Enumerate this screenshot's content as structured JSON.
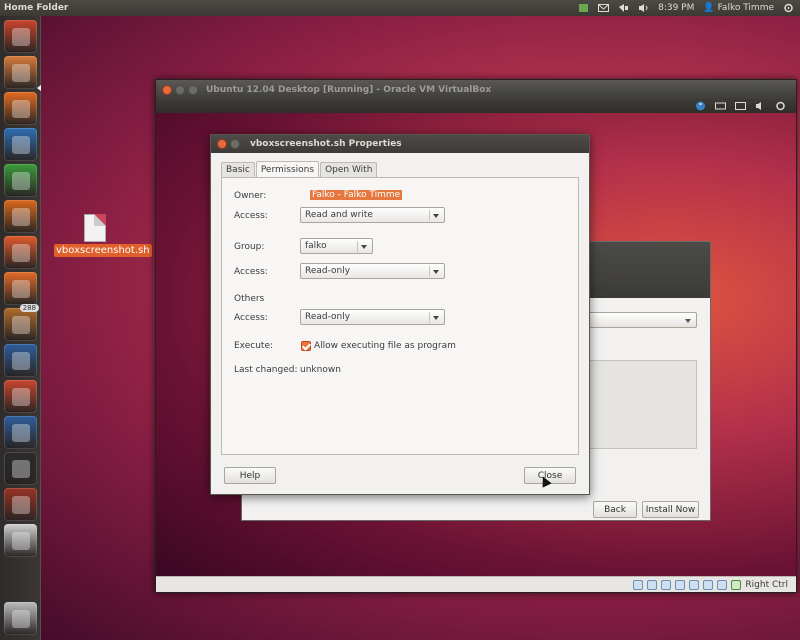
{
  "top_panel": {
    "title": "Home Folder",
    "time": "8:39 PM",
    "user": "Falko Timme",
    "icons": [
      "indicator-icon",
      "envelope-icon",
      "network-icon",
      "volume-icon",
      "gear-icon"
    ]
  },
  "launcher": {
    "items": [
      {
        "name": "ubuntu-dash-icon",
        "color": "#c9452b"
      },
      {
        "name": "home-folder-icon",
        "color": "#d97b3b"
      },
      {
        "name": "firefox-icon",
        "color": "#e36b21"
      },
      {
        "name": "writer-icon",
        "color": "#2e6fb5"
      },
      {
        "name": "calc-icon",
        "color": "#3b9c3b"
      },
      {
        "name": "impress-icon",
        "color": "#d9681e"
      },
      {
        "name": "software-center-icon",
        "color": "#e05a2b"
      },
      {
        "name": "ubuntu-one-icon",
        "color": "#e46a28"
      },
      {
        "name": "update-manager-icon",
        "color": "#b26b2c",
        "badge": "288"
      },
      {
        "name": "system-monitor-icon",
        "color": "#2d5e9c"
      },
      {
        "name": "system-settings-icon",
        "color": "#c8462e"
      },
      {
        "name": "system-monitor-2-icon",
        "color": "#2d5e9c"
      },
      {
        "name": "terminal-icon",
        "color": "#2b2b2b"
      },
      {
        "name": "workspace-switcher-icon",
        "color": "#9a3325"
      },
      {
        "name": "dvd-icon",
        "color": "#d1d1d1"
      },
      {
        "name": "trash-icon",
        "color": "#bdbdbd"
      }
    ]
  },
  "desktop": {
    "file_label": "vboxscreenshot.sh"
  },
  "vbox": {
    "title": "Ubuntu 12.04 Desktop [Running] - Oracle VM VirtualBox",
    "statusbar_label": "Right Ctrl"
  },
  "installer": {
    "back_label": "Back",
    "install_label": "Install Now"
  },
  "dialog": {
    "title": "vboxscreenshot.sh Properties",
    "tabs": [
      "Basic",
      "Permissions",
      "Open With"
    ],
    "active_tab": "Permissions",
    "owner_label": "Owner:",
    "owner_value": "Falko - Falko Timme",
    "owner_access_label": "Access:",
    "owner_access_value": "Read and write",
    "group_label": "Group:",
    "group_value": "falko",
    "group_access_label": "Access:",
    "group_access_value": "Read-only",
    "others_label": "Others",
    "others_access_label": "Access:",
    "others_access_value": "Read-only",
    "execute_label": "Execute:",
    "execute_checkbox_label": "Allow executing file as program",
    "execute_checked": true,
    "last_changed_label": "Last changed:",
    "last_changed_value": "unknown",
    "help_label": "Help",
    "close_label": "Close"
  }
}
